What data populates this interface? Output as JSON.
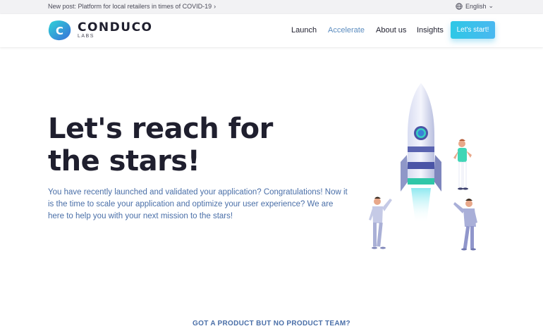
{
  "topbar": {
    "announcement": "New post: Platform for local retailers in times of COVID-19",
    "announcement_chevron": "›",
    "language": "English",
    "language_caret": "⌄"
  },
  "header": {
    "logo_word": "CONDUCO",
    "logo_sub": "LABS",
    "logo_letter": "C",
    "nav": [
      {
        "label": "Launch"
      },
      {
        "label": "Accelerate"
      },
      {
        "label": "About us"
      },
      {
        "label": "Insights"
      }
    ],
    "cta_label": "Let's start!"
  },
  "hero": {
    "title": "Let's reach for the stars!",
    "copy": "You have recently launched and validated your application? Congratulations! Now it is the time to scale your application and optimize your user experience? We are here to help you with your next mission to the stars!"
  },
  "section": {
    "teaser": "GOT A PRODUCT BUT NO PRODUCT TEAM?"
  },
  "colors": {
    "accent": "#2ec8e6",
    "nav_active": "#5b8cbf",
    "body_text": "#4a6fa8",
    "heading": "#1f1f2e"
  },
  "icons": {
    "language": "globe-icon",
    "logo": "conduco-logo-icon",
    "illustration": "rocket-launch-illustration"
  }
}
